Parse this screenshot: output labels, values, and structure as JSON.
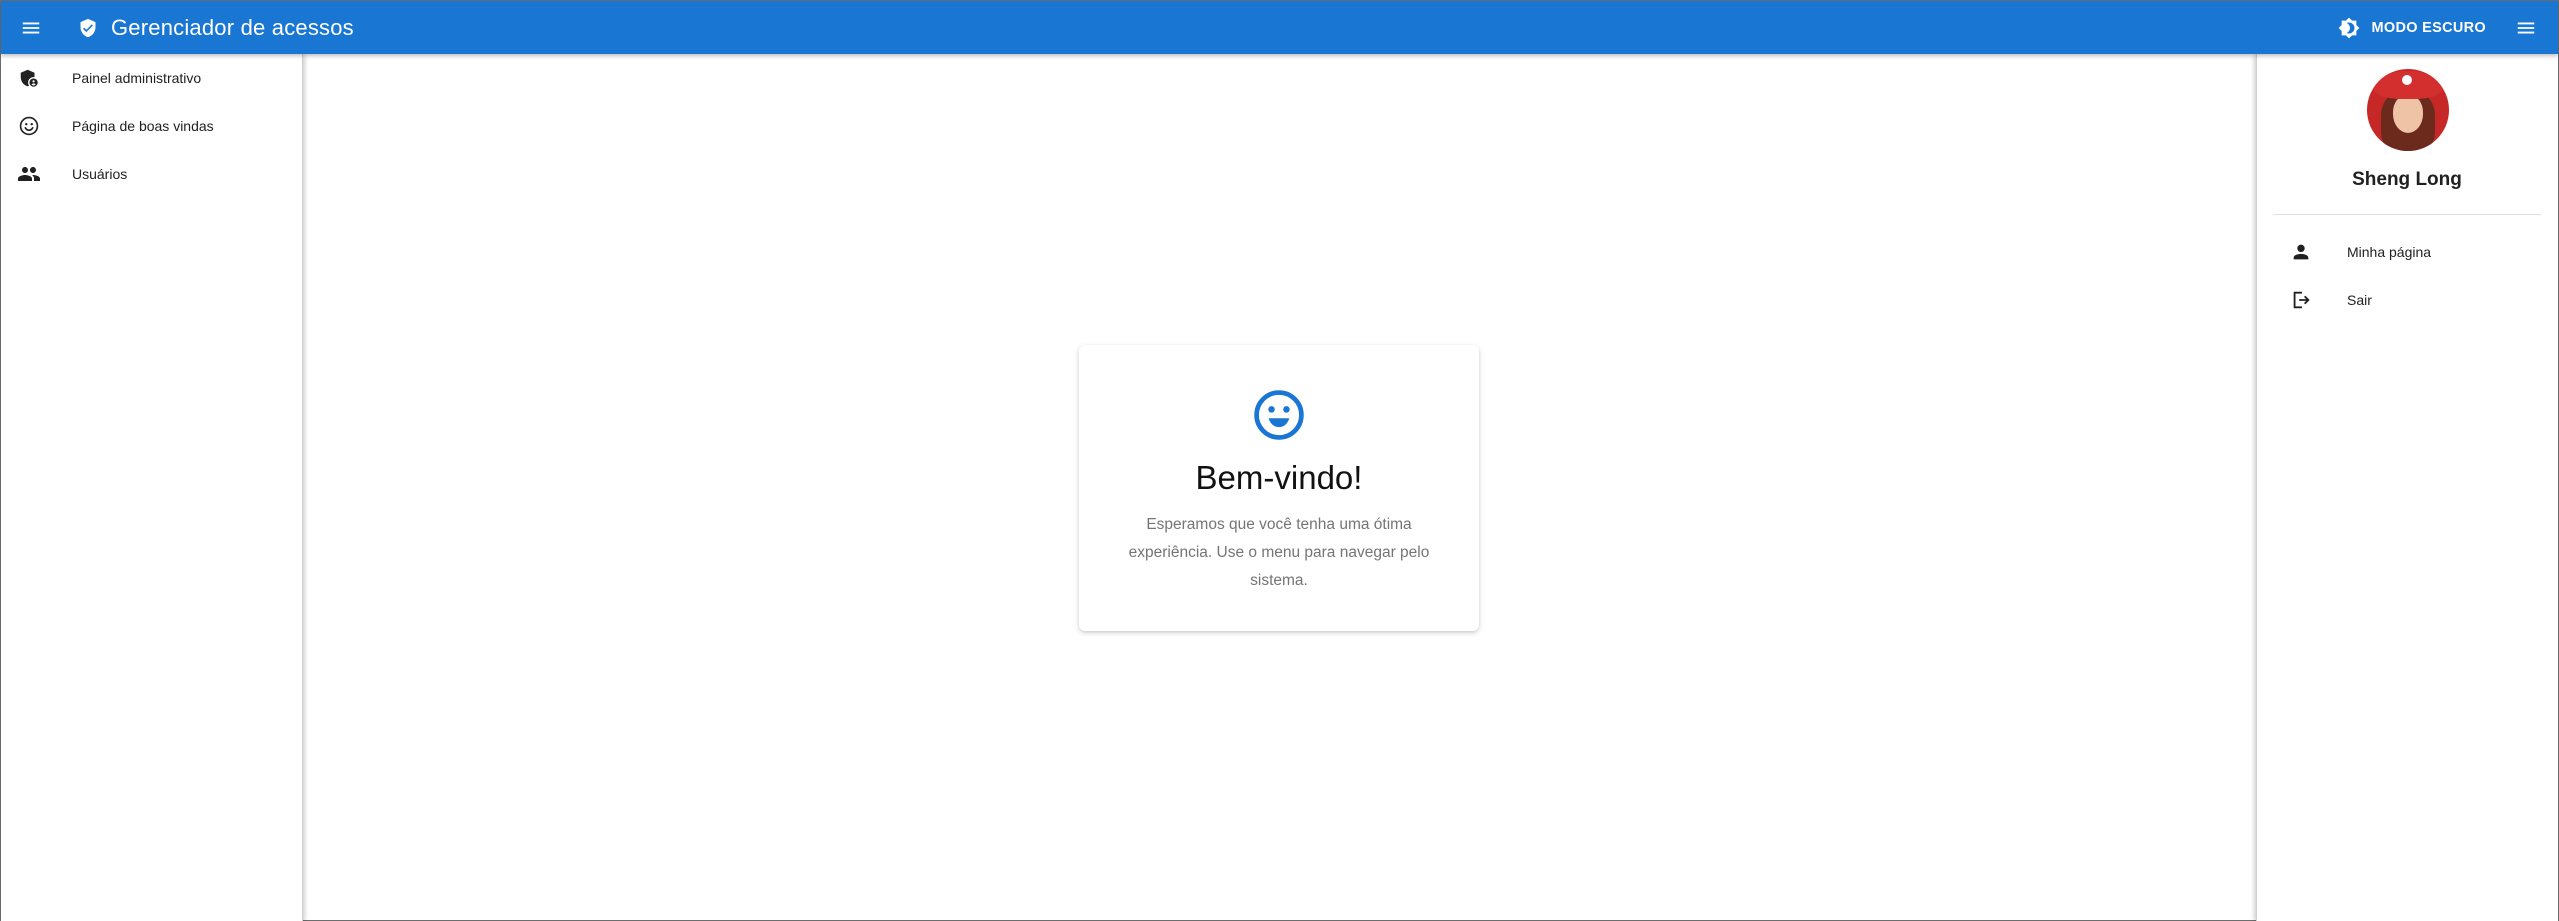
{
  "app": {
    "title": "Gerenciador de acessos"
  },
  "header": {
    "dark_mode_label": "MODO ESCURO"
  },
  "left_nav": {
    "items": [
      {
        "label": "Painel administrativo",
        "icon": "admin-shield-icon"
      },
      {
        "label": "Página de boas vindas",
        "icon": "smiley-icon"
      },
      {
        "label": "Usuários",
        "icon": "people-icon"
      }
    ]
  },
  "user_panel": {
    "name": "Sheng Long",
    "items": [
      {
        "label": "Minha página",
        "icon": "person-icon"
      },
      {
        "label": "Sair",
        "icon": "logout-icon"
      }
    ]
  },
  "welcome": {
    "title": "Bem-vindo!",
    "message": "Esperamos que você tenha uma ótima experiência. Use o menu para navegar pelo sistema."
  },
  "colors": {
    "primary": "#1976d2",
    "text_secondary": "#757575"
  }
}
